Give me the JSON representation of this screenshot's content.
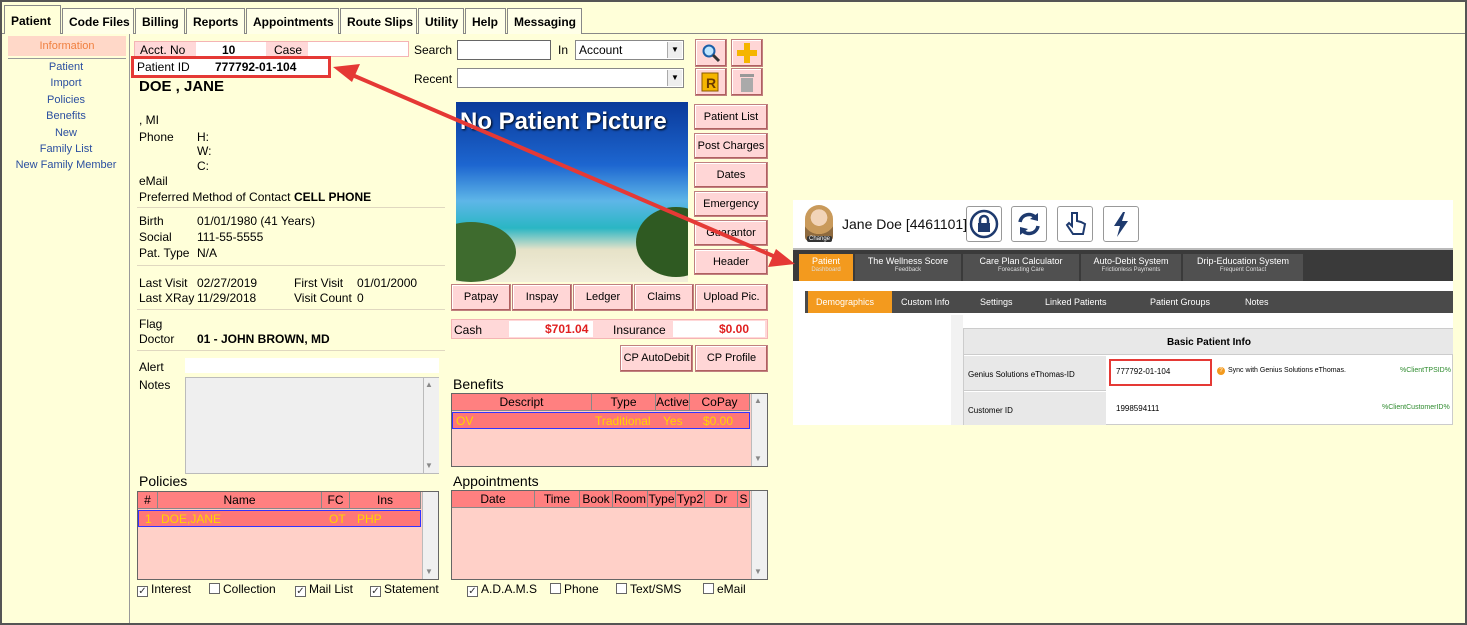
{
  "tabs": [
    "Patient",
    "Code Files",
    "Billing",
    "Reports",
    "Appointments",
    "Route Slips",
    "Utility",
    "Help",
    "Messaging"
  ],
  "sidebar": {
    "header": "Information",
    "items": [
      "Patient",
      "Import",
      "Policies",
      "Benefits",
      "New",
      "Family List",
      "New Family Member"
    ]
  },
  "patient": {
    "acct_label": "Acct. No",
    "acct_value": "10",
    "case_label": "Case",
    "patient_id_label": "Patient ID",
    "patient_id": "777792-01-104",
    "name": "DOE , JANE",
    "mi": ", MI",
    "phone_label": "Phone",
    "phone_h": "H:",
    "phone_w": "W:",
    "phone_c": "C:",
    "email_label": "eMail",
    "contact_label": "Preferred Method of Contact",
    "contact_value": "CELL PHONE",
    "birth_label": "Birth",
    "birth_value": "01/01/1980 (41 Years)",
    "social_label": "Social",
    "social_value": "111-55-5555",
    "pattype_label": "Pat. Type",
    "pattype_value": "N/A",
    "lastvisit_label": "Last Visit",
    "lastvisit_value": "02/27/2019",
    "firstvisit_label": "First Visit",
    "firstvisit_value": "01/01/2000",
    "lastxray_label": "Last XRay",
    "lastxray_value": "11/29/2018",
    "visitcount_label": "Visit Count",
    "visitcount_value": "0",
    "flag_label": "Flag",
    "doctor_label": "Doctor",
    "doctor_value": "01 - JOHN BROWN, MD",
    "alert_label": "Alert",
    "notes_label": "Notes"
  },
  "search": {
    "search_label": "Search",
    "in_label": "In",
    "in_value": "Account",
    "recent_label": "Recent"
  },
  "picture_caption": "No Patient Picture",
  "right_buttons": [
    "Patient List",
    "Post Charges",
    "Dates",
    "Emergency",
    "Guarantor",
    "Header"
  ],
  "bottom_buttons": [
    "Patpay",
    "Inspay",
    "Ledger",
    "Claims",
    "Upload Pic."
  ],
  "cash": {
    "cash_label": "Cash",
    "cash_value": "$701.04",
    "ins_label": "Insurance",
    "ins_value": "$0.00"
  },
  "cp_buttons": [
    "CP AutoDebit",
    "CP Profile"
  ],
  "benefits": {
    "title": "Benefits",
    "headers": [
      "Descript",
      "Type",
      "Active",
      "CoPay"
    ],
    "row": [
      "OV",
      "Traditional",
      "Yes",
      "$0.00"
    ]
  },
  "policies": {
    "title": "Policies",
    "headers": [
      "#",
      "Name",
      "FC",
      "Ins"
    ],
    "row": [
      "1",
      "DOE,JANE",
      "OT",
      "PHP"
    ]
  },
  "appointments": {
    "title": "Appointments",
    "headers": [
      "Date",
      "Time",
      "Book",
      "Room",
      "Type",
      "Typ2",
      "Dr",
      "S"
    ]
  },
  "policy_checks": [
    {
      "label": "Interest",
      "checked": true
    },
    {
      "label": "Collection",
      "checked": false
    },
    {
      "label": "Mail List",
      "checked": true
    },
    {
      "label": "Statement",
      "checked": true
    }
  ],
  "appt_checks": [
    {
      "label": "A.D.A.M.S",
      "checked": true
    },
    {
      "label": "Phone",
      "checked": false
    },
    {
      "label": "Text/SMS",
      "checked": false
    },
    {
      "label": "eMail",
      "checked": false
    }
  ],
  "web": {
    "patient_name": "Jane Doe [4461101]",
    "avatar_caption": "Change",
    "nav": [
      {
        "label": "Patient",
        "sub": "Dashboard"
      },
      {
        "label": "The Wellness Score",
        "sub": "Feedback"
      },
      {
        "label": "Care Plan Calculator",
        "sub": "Forecasting Care"
      },
      {
        "label": "Auto-Debit System",
        "sub": "Frictionless Payments"
      },
      {
        "label": "Drip-Education System",
        "sub": "Frequent Contact"
      }
    ],
    "subtabs": [
      "Demographics",
      "Custom Info",
      "Settings",
      "Linked Patients",
      "Patient Groups",
      "Notes"
    ],
    "panel_title": "Basic Patient Info",
    "row1_label": "Genius Solutions eThomas-ID",
    "row1_value": "777792-01-104",
    "row1_sync": "Sync with Genius Solutions eThomas.",
    "row1_var": "%ClientTPSID%",
    "row2_label": "Customer ID",
    "row2_value": "1998594111",
    "row2_var": "%ClientCustomerID%"
  },
  "colors": {
    "accent_orange": "#F39A1E",
    "highlight_red": "#E53935",
    "bg_yellow": "#FFFFD9"
  }
}
